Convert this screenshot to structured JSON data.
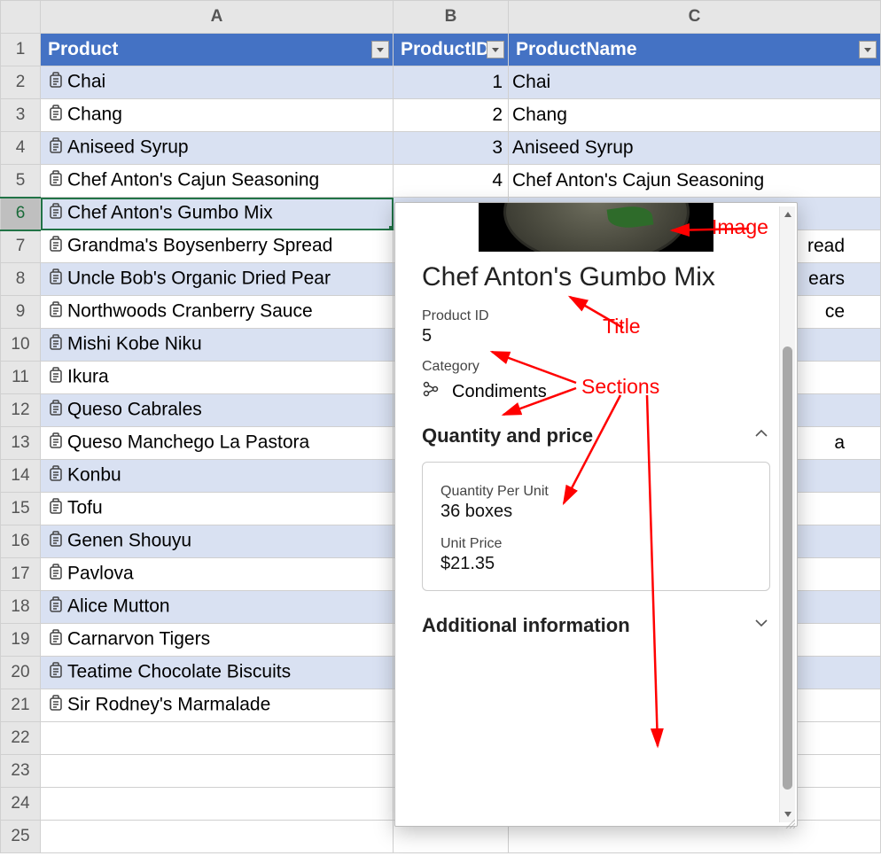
{
  "columns": {
    "letters": [
      "A",
      "B",
      "C"
    ],
    "headers": [
      "Product",
      "ProductID",
      "ProductName"
    ]
  },
  "selected_row_index": 4,
  "rows": [
    {
      "num": "2",
      "product": "Chai",
      "pid": "1",
      "pname": "Chai",
      "band": true
    },
    {
      "num": "3",
      "product": "Chang",
      "pid": "2",
      "pname": "Chang",
      "band": false
    },
    {
      "num": "4",
      "product": "Aniseed Syrup",
      "pid": "3",
      "pname": "Aniseed Syrup",
      "band": true
    },
    {
      "num": "5",
      "product": "Chef Anton's Cajun Seasoning",
      "pid": "4",
      "pname": "Chef Anton's Cajun Seasoning",
      "band": false
    },
    {
      "num": "6",
      "product": "Chef Anton's Gumbo Mix",
      "pid": "",
      "pname": "",
      "band": true
    },
    {
      "num": "7",
      "product": "Grandma's Boysenberry Spread",
      "pid": "",
      "pname": "read",
      "band": false,
      "truncA": "Grandma's Boysenberry Spread"
    },
    {
      "num": "8",
      "product": "Uncle Bob's Organic Dried Pear",
      "pid": "",
      "pname": "ears",
      "band": true
    },
    {
      "num": "9",
      "product": "Northwoods Cranberry Sauce",
      "pid": "",
      "pname": "ce",
      "band": false
    },
    {
      "num": "10",
      "product": "Mishi Kobe Niku",
      "pid": "",
      "pname": "",
      "band": true
    },
    {
      "num": "11",
      "product": "Ikura",
      "pid": "",
      "pname": "",
      "band": false
    },
    {
      "num": "12",
      "product": "Queso Cabrales",
      "pid": "",
      "pname": "",
      "band": true
    },
    {
      "num": "13",
      "product": "Queso Manchego La Pastora",
      "pid": "",
      "pname": "a",
      "band": false
    },
    {
      "num": "14",
      "product": "Konbu",
      "pid": "",
      "pname": "",
      "band": true
    },
    {
      "num": "15",
      "product": "Tofu",
      "pid": "",
      "pname": "",
      "band": false
    },
    {
      "num": "16",
      "product": "Genen Shouyu",
      "pid": "",
      "pname": "",
      "band": true
    },
    {
      "num": "17",
      "product": "Pavlova",
      "pid": "",
      "pname": "",
      "band": false
    },
    {
      "num": "18",
      "product": "Alice Mutton",
      "pid": "",
      "pname": "",
      "band": true
    },
    {
      "num": "19",
      "product": "Carnarvon Tigers",
      "pid": "",
      "pname": "",
      "band": false
    },
    {
      "num": "20",
      "product": "Teatime Chocolate Biscuits",
      "pid": "",
      "pname": "",
      "band": true
    },
    {
      "num": "21",
      "product": "Sir Rodney's Marmalade",
      "pid": "",
      "pname": "",
      "band": false
    }
  ],
  "empty_rows": [
    "22",
    "23",
    "24",
    "25"
  ],
  "card": {
    "title": "Chef Anton's Gumbo Mix",
    "product_id_label": "Product ID",
    "product_id_value": "5",
    "category_label": "Category",
    "category_value": "Condiments",
    "section_qty_title": "Quantity and price",
    "qty_label": "Quantity Per Unit",
    "qty_value": "36 boxes",
    "price_label": "Unit Price",
    "price_value": "$21.35",
    "section_add_title": "Additional information"
  },
  "annotations": {
    "image": "Image",
    "title": "Title",
    "sections": "Sections"
  }
}
